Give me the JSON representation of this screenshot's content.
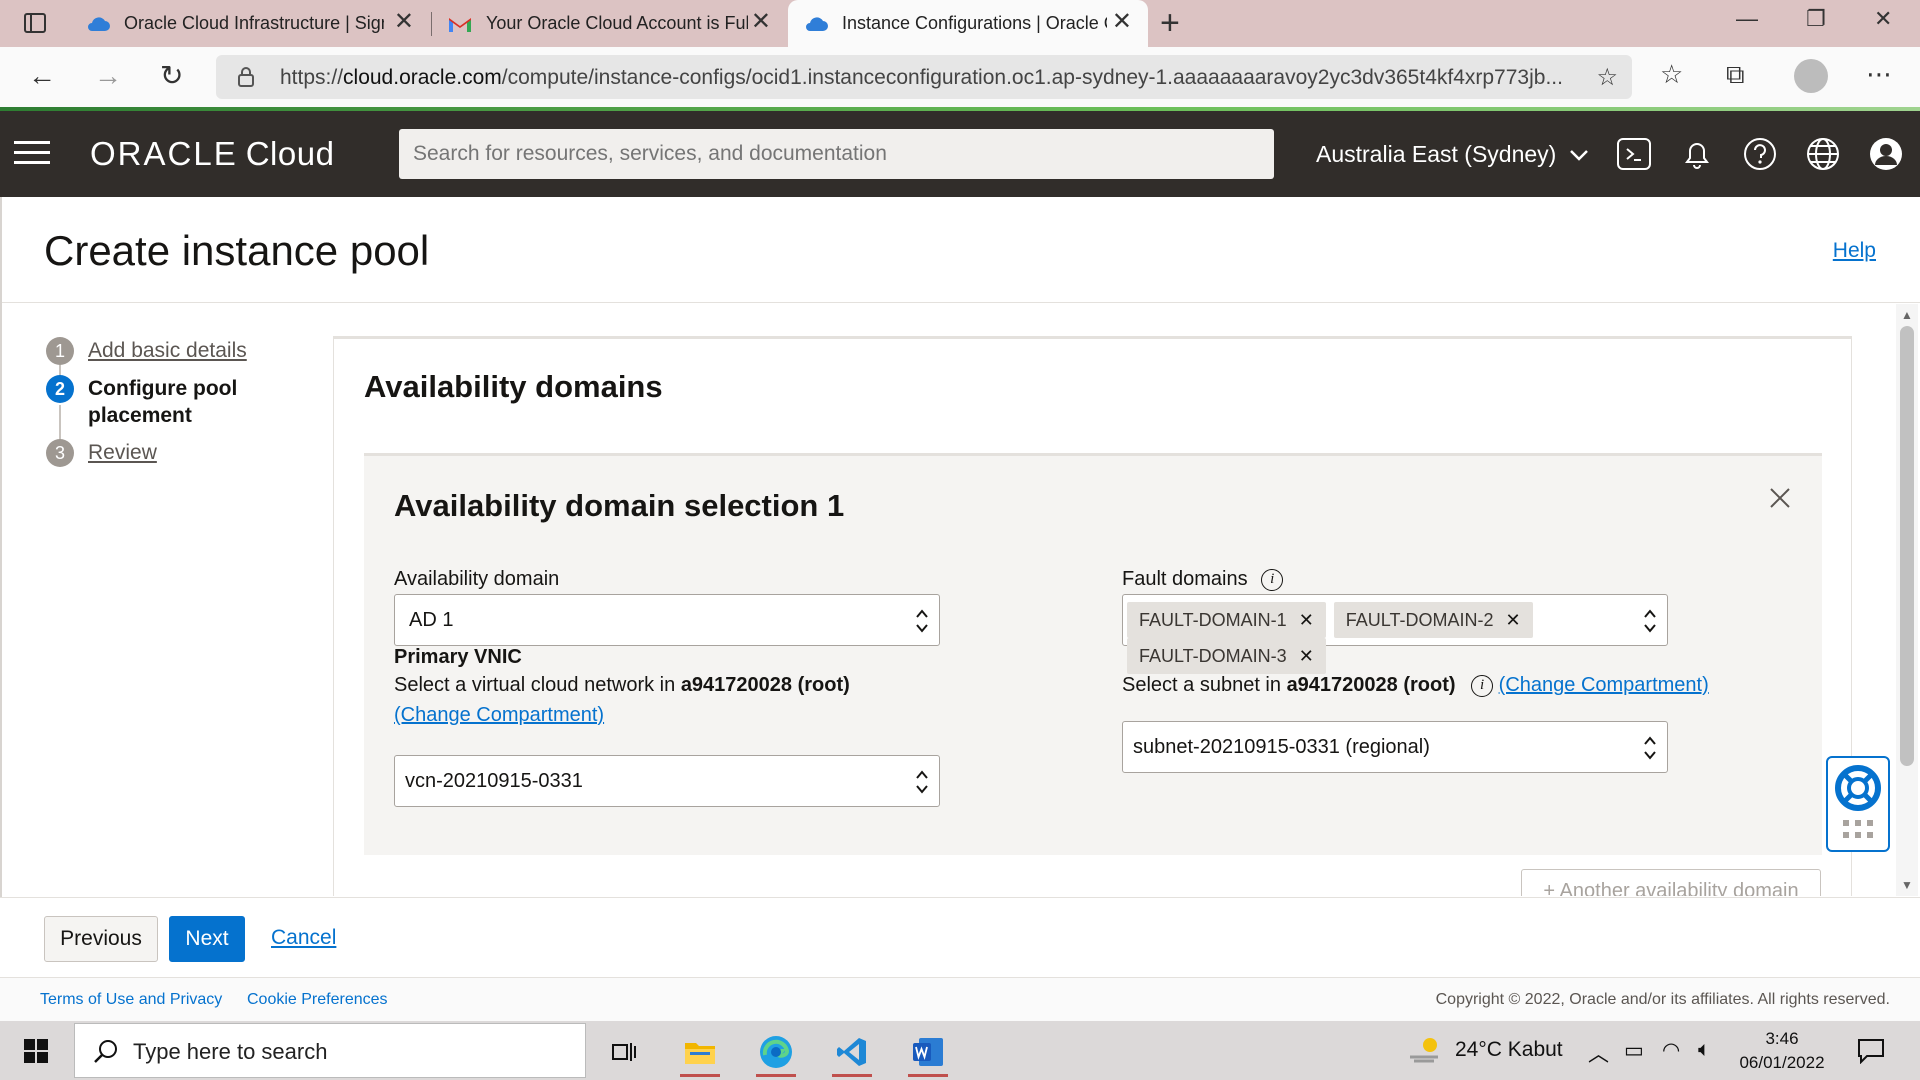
{
  "browser": {
    "tabs": [
      {
        "title": "Oracle Cloud Infrastructure | Sign",
        "icon": "oracle-cloud-favicon"
      },
      {
        "title": "Your Oracle Cloud Account is Ful",
        "icon": "gmail-favicon"
      },
      {
        "title": "Instance Configurations | Oracle C",
        "icon": "oracle-cloud-favicon",
        "active": true
      }
    ],
    "url_prefix": "https://",
    "url_domain": "cloud.oracle.com",
    "url_rest": "/compute/instance-configs/ocid1.instanceconfiguration.oc1.ap-sydney-1.aaaaaaaaravoy2yc3dv365t4kf4xrp773jb..."
  },
  "header": {
    "brand_oracle": "ORACLE",
    "brand_cloud": "Cloud",
    "search_placeholder": "Search for resources, services, and documentation",
    "region": "Australia East (Sydney)"
  },
  "page": {
    "title": "Create instance pool",
    "help": "Help"
  },
  "steps": [
    {
      "num": "1",
      "label": "Add basic details",
      "state": "done"
    },
    {
      "num": "2",
      "label": "Configure pool placement",
      "label_line1": "Configure pool",
      "label_line2": "placement",
      "state": "active"
    },
    {
      "num": "3",
      "label": "Review",
      "state": "todo"
    }
  ],
  "section": {
    "title": "Availability domains",
    "panel_title": "Availability domain selection 1",
    "ad_label": "Availability domain",
    "ad_value": "AD 1",
    "fault_label": "Fault domains",
    "fault_tags": [
      "FAULT-DOMAIN-1",
      "FAULT-DOMAIN-2",
      "FAULT-DOMAIN-3"
    ],
    "vnic_heading": "Primary VNIC",
    "vcn_label_prefix": "Select a virtual cloud network in",
    "compartment": "a941720028 (root)",
    "change_compartment": "(Change Compartment)",
    "vcn_value": "vcn-20210915-0331",
    "subnet_label_prefix": "Select a subnet in",
    "subnet_value": "subnet-20210915-0331 (regional)",
    "another_ad": "+ Another availability domain"
  },
  "actions": {
    "previous": "Previous",
    "next": "Next",
    "cancel": "Cancel"
  },
  "footer": {
    "terms": "Terms of Use and Privacy",
    "cookies": "Cookie Preferences",
    "copyright": "Copyright © 2022, Oracle and/or its affiliates. All rights reserved."
  },
  "taskbar": {
    "search_placeholder": "Type here to search",
    "weather": "24°C  Kabut",
    "time": "3:46",
    "date": "06/01/2022"
  },
  "colors": {
    "oci_header": "#312d2a",
    "link": "#0572ce",
    "primary_button": "#0572ce"
  }
}
